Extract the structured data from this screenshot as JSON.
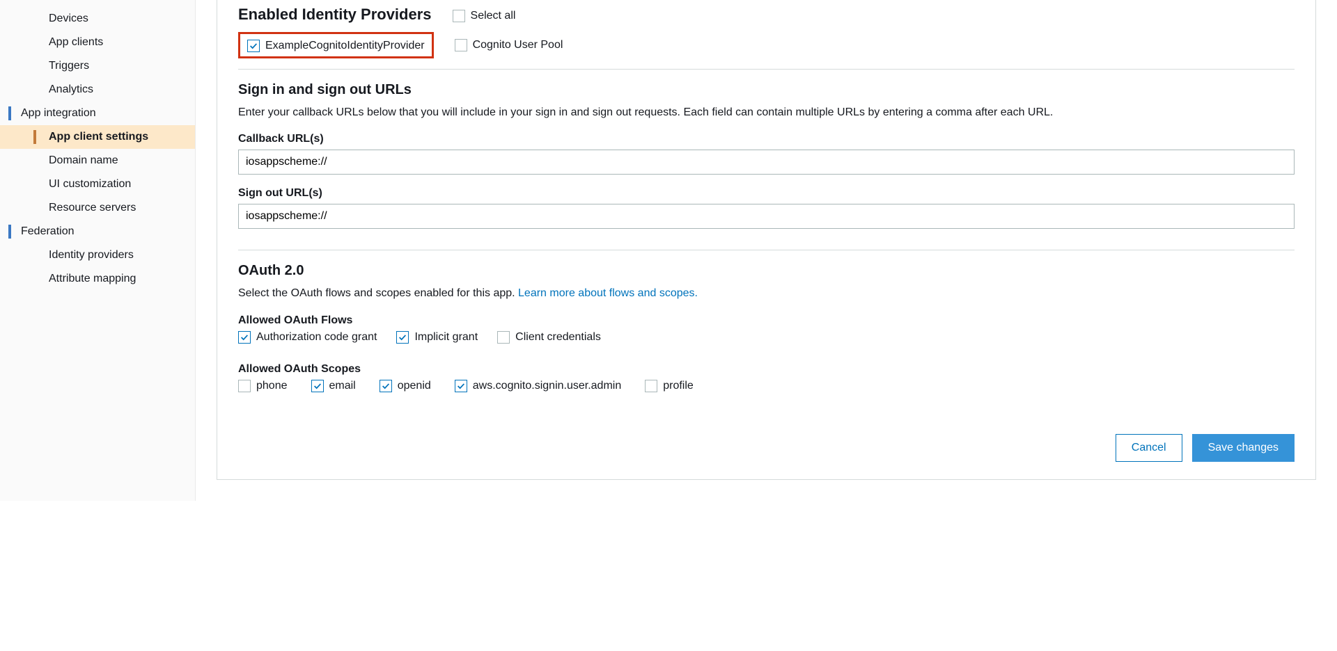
{
  "sidebar": {
    "items": [
      {
        "label": "Devices",
        "level": 2
      },
      {
        "label": "App clients",
        "level": 2
      },
      {
        "label": "Triggers",
        "level": 2
      },
      {
        "label": "Analytics",
        "level": 2
      },
      {
        "label": "App integration",
        "level": 1
      },
      {
        "label": "App client settings",
        "level": 2,
        "active": true
      },
      {
        "label": "Domain name",
        "level": 2
      },
      {
        "label": "UI customization",
        "level": 2
      },
      {
        "label": "Resource servers",
        "level": 2
      },
      {
        "label": "Federation",
        "level": 1
      },
      {
        "label": "Identity providers",
        "level": 2
      },
      {
        "label": "Attribute mapping",
        "level": 2
      }
    ]
  },
  "idp": {
    "heading": "Enabled Identity Providers",
    "select_all": "Select all",
    "provider1": "ExampleCognitoIdentityProvider",
    "provider2": "Cognito User Pool"
  },
  "urls": {
    "heading": "Sign in and sign out URLs",
    "desc": "Enter your callback URLs below that you will include in your sign in and sign out requests. Each field can contain multiple URLs by entering a comma after each URL.",
    "callback_label": "Callback URL(s)",
    "callback_value": "iosappscheme://",
    "signout_label": "Sign out URL(s)",
    "signout_value": "iosappscheme://"
  },
  "oauth": {
    "heading": "OAuth 2.0",
    "desc_prefix": "Select the OAuth flows and scopes enabled for this app. ",
    "learn_link": "Learn more about flows and scopes.",
    "flows_label": "Allowed OAuth Flows",
    "flow1": "Authorization code grant",
    "flow2": "Implicit grant",
    "flow3": "Client credentials",
    "scopes_label": "Allowed OAuth Scopes",
    "scope1": "phone",
    "scope2": "email",
    "scope3": "openid",
    "scope4": "aws.cognito.signin.user.admin",
    "scope5": "profile"
  },
  "buttons": {
    "cancel": "Cancel",
    "save": "Save changes"
  }
}
